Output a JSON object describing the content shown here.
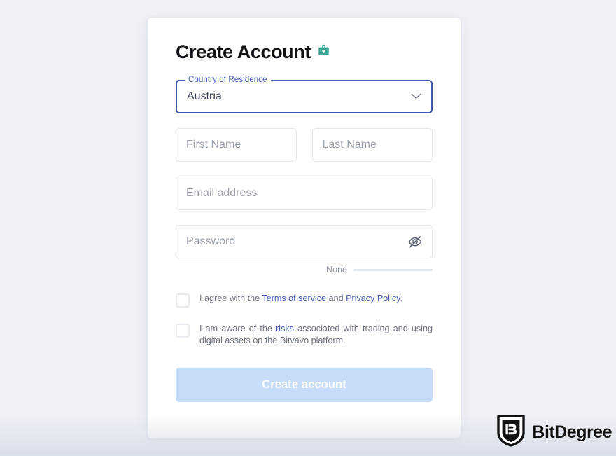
{
  "page": {
    "background_color": "#eef1f6",
    "card_background": "#ffffff"
  },
  "header": {
    "title": "Create Account",
    "icon": "briefcase-lock-icon",
    "icon_color": "#3aa594"
  },
  "form": {
    "country_select": {
      "legend": "Country of Residence",
      "value": "Austria",
      "chevron_icon": "chevron-down-icon",
      "border_color": "#4257b2",
      "legend_color": "#4257b2"
    },
    "first_name": {
      "placeholder": "First Name",
      "value": ""
    },
    "last_name": {
      "placeholder": "Last Name",
      "value": ""
    },
    "email": {
      "placeholder": "Email address",
      "value": ""
    },
    "password": {
      "placeholder": "Password",
      "value": "",
      "toggle_icon": "eye-off-icon"
    },
    "password_strength": {
      "label": "None",
      "bar_color": "#dfe3ea",
      "fill_percent": 0
    },
    "terms_checkbox": {
      "checked": false,
      "text_before": "I agree with the ",
      "link1": "Terms of service",
      "text_middle": " and ",
      "link2": "Privacy Policy",
      "text_after": "."
    },
    "risks_checkbox": {
      "checked": false,
      "text_before": "I am aware of the ",
      "link1": "risks",
      "text_after": " associated with trading and using digital assets on the Bitvavo platform."
    },
    "submit_button": {
      "label": "Create account",
      "enabled": false,
      "background_color": "#c7dcf8",
      "text_color": "#ffffff"
    }
  },
  "watermark": {
    "logo_letter": "B",
    "brand": "BitDegree"
  }
}
